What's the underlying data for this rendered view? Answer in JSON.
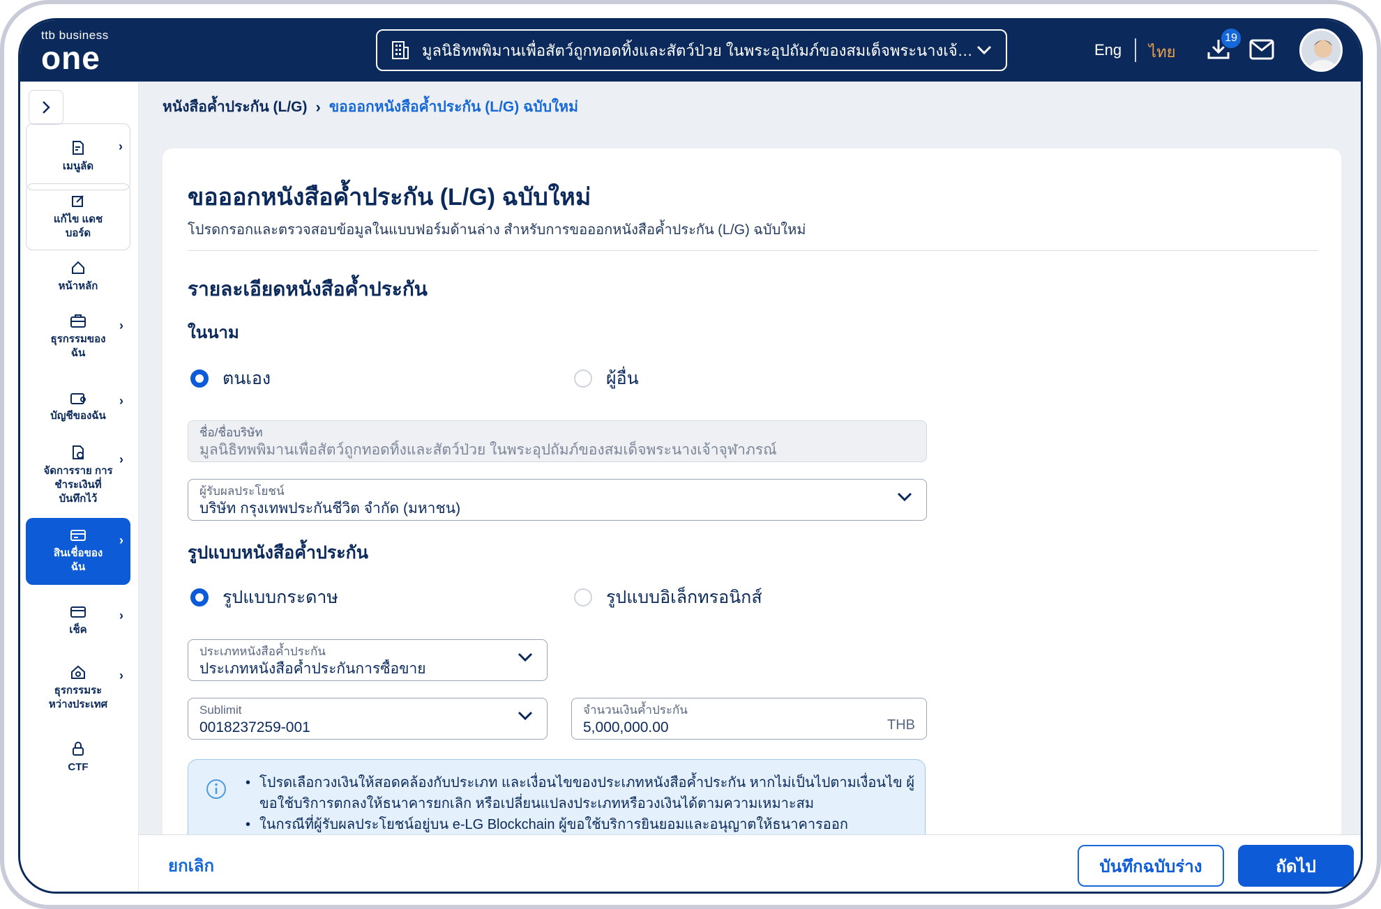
{
  "header": {
    "logo_small": "ttb business",
    "logo_big": "one",
    "company": "มูลนิธิทพพิมานเพื่อสัตว์ถูกทอดทิ้งและสัตว์ป่วย ในพระอุปถัมภ์ของสมเด็จพระนางเจ้า...",
    "lang_en": "Eng",
    "lang_th": "ไทย",
    "download_badge": "19"
  },
  "sidebar": {
    "items": [
      {
        "label": "เมนูลัด",
        "icon": "doc-shortcut-icon"
      },
      {
        "label": "แก้ไข แดชบอร์ด",
        "icon": "edit-icon"
      },
      {
        "label": "หน้าหลัก",
        "icon": "home-icon"
      },
      {
        "label": "ธุรกรรมของ ฉัน",
        "icon": "briefcase-icon"
      },
      {
        "label": "บัญชีของฉัน",
        "icon": "wallet-icon"
      },
      {
        "label": "จัดการราย การชำระเงินที่ บันทึกไว้",
        "icon": "doc-payment-icon"
      },
      {
        "label": "สินเชื่อของ ฉัน",
        "icon": "card-icon"
      },
      {
        "label": "เช็ค",
        "icon": "cheque-icon"
      },
      {
        "label": "ธุรกรรมระ หว่างประเทศ",
        "icon": "international-icon"
      },
      {
        "label": "CTF",
        "icon": "lock-icon"
      }
    ]
  },
  "breadcrumb": {
    "parent": "หนังสือค้ำประกัน (L/G)",
    "current": "ขอออกหนังสือค้ำประกัน (L/G) ฉบับใหม่"
  },
  "form": {
    "title": "ขอออกหนังสือค้ำประกัน (L/G) ฉบับใหม่",
    "subtitle": "โปรดกรอกและตรวจสอบข้อมูลในแบบฟอร์มด้านล่าง สำหรับการขอออกหนังสือค้ำประกัน (L/G) ฉบับใหม่",
    "section_title": "รายละเอียดหนังสือค้ำประกัน",
    "on_behalf_label": "ในนาม",
    "on_behalf_self": "ตนเอง",
    "on_behalf_other": "ผู้อื่น",
    "company_name_label": "ชื่อ/ชื่อบริษัท",
    "company_name_value": "มูลนิธิทพพิมานเพื่อสัตว์ถูกทอดทิ้งและสัตว์ป่วย ในพระอุปถัมภ์ของสมเด็จพระนางเจ้าจุฬาภรณ์",
    "beneficiary_label": "ผู้รับผลประโยชน์",
    "beneficiary_value": "บริษัท กรุงเทพประกันชีวิต จำกัด (มหาชน)",
    "format_title": "รูปแบบหนังสือค้ำประกัน",
    "format_paper": "รูปแบบกระดาษ",
    "format_electronic": "รูปแบบอิเล็กทรอนิกส์",
    "lg_type_label": "ประเภทหนังสือค้ำประกัน",
    "lg_type_value": "ประเภทหนังสือค้ำประกันการซื้อขาย",
    "sublimit_label": "Sublimit",
    "sublimit_value": "0018237259-001",
    "amount_label": "จำนวนเงินค้ำประกัน",
    "amount_value": "5,000,000.00",
    "amount_unit": "THB",
    "info_lines": [
      "โปรดเลือกวงเงินให้สอดคล้องกับประเภท และเงื่อนไขของประเภทหนังสือค้ำประกัน หากไม่เป็นไปตามเงื่อนไข ผู้ขอใช้บริการตกลงให้ธนาคารยกเลิก หรือเปลี่ยนแปลงประเภทหรือวงเงินได้ตามความเหมาะสม",
      "ในกรณีที่ผู้รับผลประโยชน์อยู่บน e-LG Blockchain ผู้ขอใช้บริการยินยอมและอนุญาตให้ธนาคารออก"
    ]
  },
  "footer": {
    "cancel": "ยกเลิก",
    "save_draft": "บันทึกฉบับร่าง",
    "next": "ถัดไป"
  },
  "colors": {
    "navy": "#0b2a5b",
    "primary": "#0d5bd6",
    "accent_orange": "#f0a24a"
  }
}
